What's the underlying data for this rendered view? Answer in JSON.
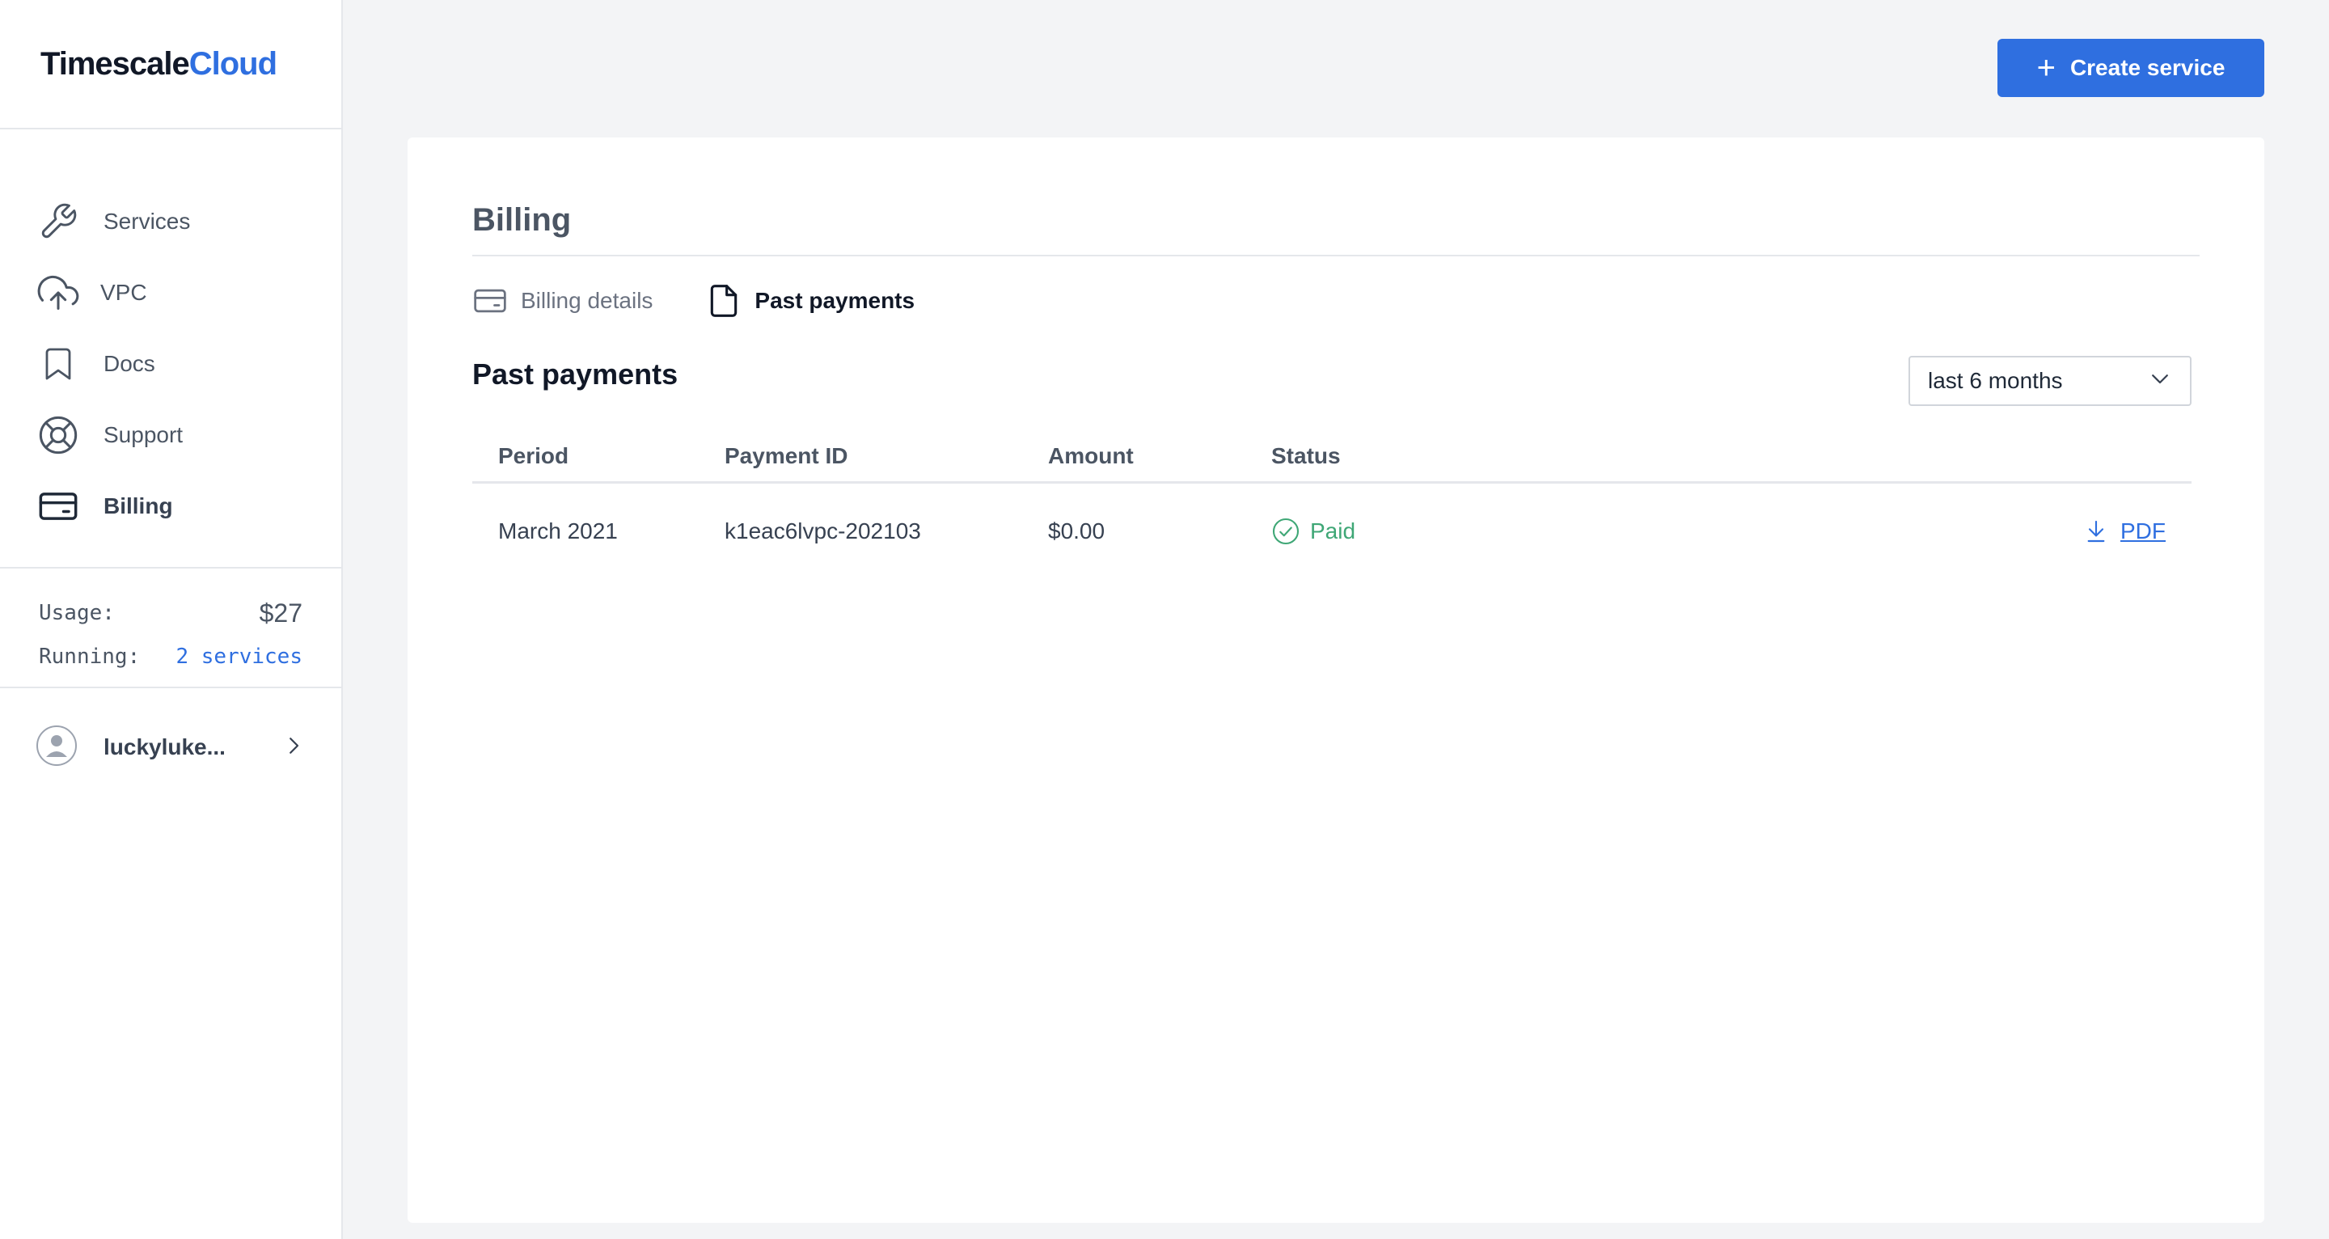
{
  "app": {
    "logo_main": "Timescale",
    "logo_accent": "Cloud"
  },
  "sidebar": {
    "items": [
      {
        "label": "Services",
        "icon": "wrench-icon"
      },
      {
        "label": "VPC",
        "icon": "cloud-upload-icon"
      },
      {
        "label": "Docs",
        "icon": "bookmark-icon"
      },
      {
        "label": "Support",
        "icon": "lifebuoy-icon"
      },
      {
        "label": "Billing",
        "icon": "credit-card-icon",
        "active": true
      }
    ],
    "usage_label": "Usage:",
    "usage_value": "$27",
    "running_label": "Running:",
    "running_value": "2 services",
    "user_name": "luckyluke..."
  },
  "header": {
    "create_label": "Create service"
  },
  "billing": {
    "title": "Billing",
    "tabs": [
      {
        "label": "Billing details",
        "icon": "credit-card-icon"
      },
      {
        "label": "Past payments",
        "icon": "document-icon",
        "active": true
      }
    ],
    "section_title": "Past payments",
    "range_value": "last 6 months",
    "columns": [
      "Period",
      "Payment ID",
      "Amount",
      "Status"
    ],
    "rows": [
      {
        "period": "March 2021",
        "payment_id": "k1eac6lvpc-202103",
        "amount": "$0.00",
        "status": "Paid",
        "download": "PDF"
      }
    ]
  },
  "colors": {
    "accent": "#2f6fe0",
    "paid": "#3fa776",
    "background": "#f3f4f6"
  }
}
